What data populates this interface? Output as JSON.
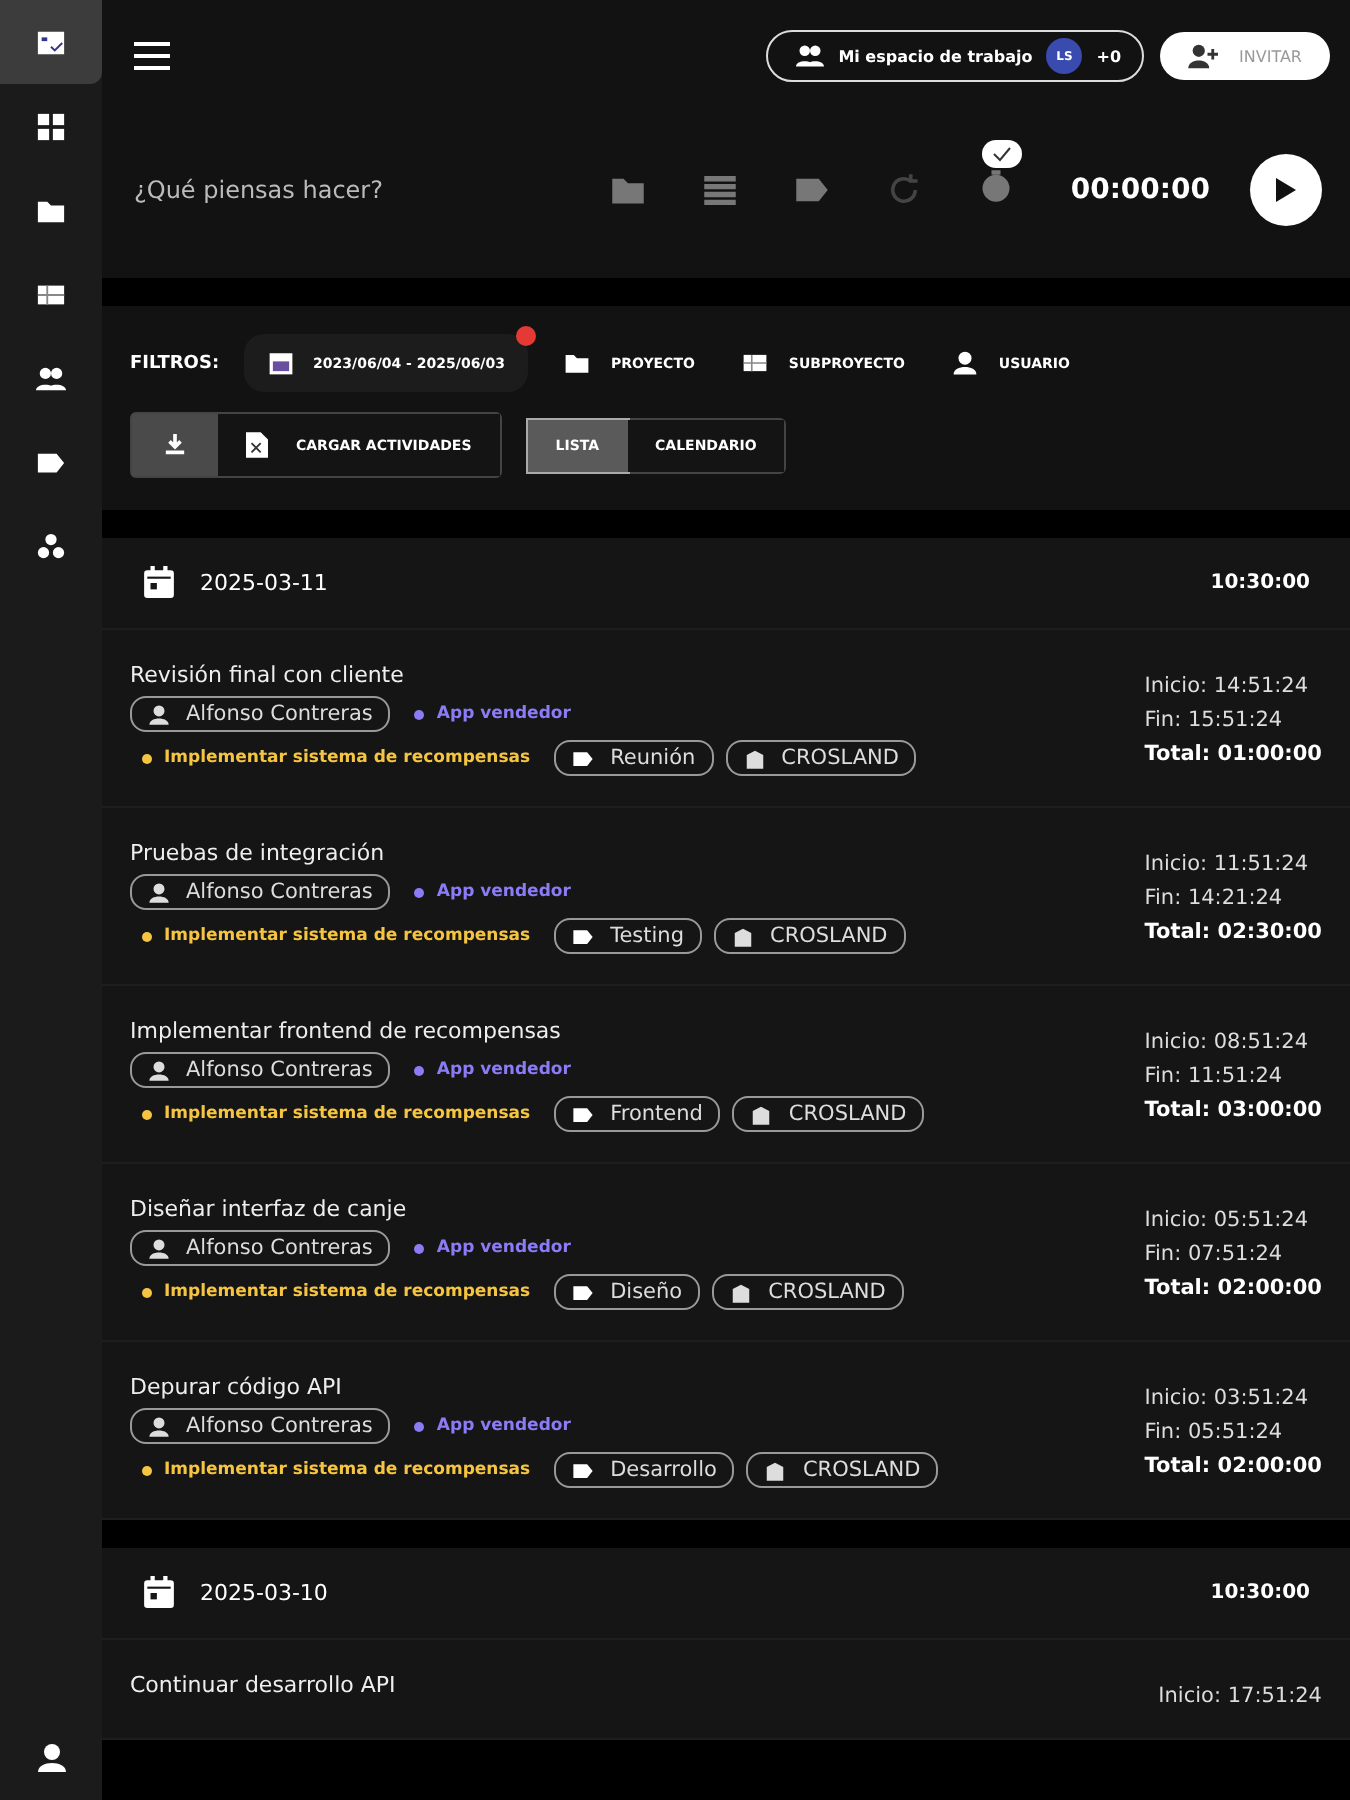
{
  "sidebar": {
    "items": [
      {
        "kind": "tasks",
        "selected": true
      },
      {
        "kind": "dashboard",
        "selected": false
      },
      {
        "kind": "folder",
        "selected": false
      },
      {
        "kind": "table",
        "selected": false
      },
      {
        "kind": "people",
        "selected": false
      },
      {
        "kind": "tag",
        "selected": false
      },
      {
        "kind": "cluster",
        "selected": false
      }
    ]
  },
  "topbar": {
    "workspace": "Mi espacio de trabajo",
    "avatar": "LS",
    "extra": "+0",
    "invite": "INVITAR"
  },
  "timer": {
    "placeholder": "¿Qué piensas hacer?",
    "time": "00:00:00"
  },
  "filters": {
    "label": "FILTROS:",
    "date_range": "2023/06/04 - 2025/06/03",
    "date_alert": true,
    "items": [
      {
        "kind": "folder",
        "label": "PROYECTO"
      },
      {
        "kind": "table",
        "label": "SUBPROYECTO"
      },
      {
        "kind": "user",
        "label": "USUARIO"
      }
    ],
    "upload": "CARGAR ACTIVIDADES",
    "views": [
      {
        "label": "LISTA",
        "selected": true
      },
      {
        "label": "CALENDARIO",
        "selected": false
      }
    ]
  },
  "days": [
    {
      "date": "2025-03-11",
      "total": "10:30:00",
      "entries": [
        {
          "title": "Revisión final con cliente",
          "user": "Alfonso Contreras",
          "project": {
            "name": "App vendedor",
            "color": "#8b7cf6"
          },
          "task": {
            "name": "Implementar sistema de recompensas",
            "color": "#f5c542"
          },
          "tag": "Reunión",
          "client": "CROSLAND",
          "start": "Inicio: 14:51:24",
          "end": "Fin: 15:51:24",
          "total": "Total: 01:00:00"
        },
        {
          "title": "Pruebas de integración",
          "user": "Alfonso Contreras",
          "project": {
            "name": "App vendedor",
            "color": "#8b7cf6"
          },
          "task": {
            "name": "Implementar sistema de recompensas",
            "color": "#f5c542"
          },
          "tag": "Testing",
          "client": "CROSLAND",
          "start": "Inicio: 11:51:24",
          "end": "Fin: 14:21:24",
          "total": "Total: 02:30:00"
        },
        {
          "title": "Implementar frontend de recompensas",
          "user": "Alfonso Contreras",
          "project": {
            "name": "App vendedor",
            "color": "#8b7cf6"
          },
          "task": {
            "name": "Implementar sistema de recompensas",
            "color": "#f5c542"
          },
          "tag": "Frontend",
          "client": "CROSLAND",
          "start": "Inicio: 08:51:24",
          "end": "Fin: 11:51:24",
          "total": "Total: 03:00:00"
        },
        {
          "title": "Diseñar interfaz de canje",
          "user": "Alfonso Contreras",
          "project": {
            "name": "App vendedor",
            "color": "#8b7cf6"
          },
          "task": {
            "name": "Implementar sistema de recompensas",
            "color": "#f5c542"
          },
          "tag": "Diseño",
          "client": "CROSLAND",
          "start": "Inicio: 05:51:24",
          "end": "Fin: 07:51:24",
          "total": "Total: 02:00:00"
        },
        {
          "title": "Depurar código API",
          "user": "Alfonso Contreras",
          "project": {
            "name": "App vendedor",
            "color": "#8b7cf6"
          },
          "task": {
            "name": "Implementar sistema de recompensas",
            "color": "#f5c542"
          },
          "tag": "Desarrollo",
          "client": "CROSLAND",
          "start": "Inicio: 03:51:24",
          "end": "Fin: 05:51:24",
          "total": "Total: 02:00:00"
        }
      ]
    },
    {
      "date": "2025-03-10",
      "total": "10:30:00",
      "entries": [
        {
          "title": "Continuar desarrollo API",
          "start": "Inicio: 17:51:24"
        }
      ]
    }
  ]
}
